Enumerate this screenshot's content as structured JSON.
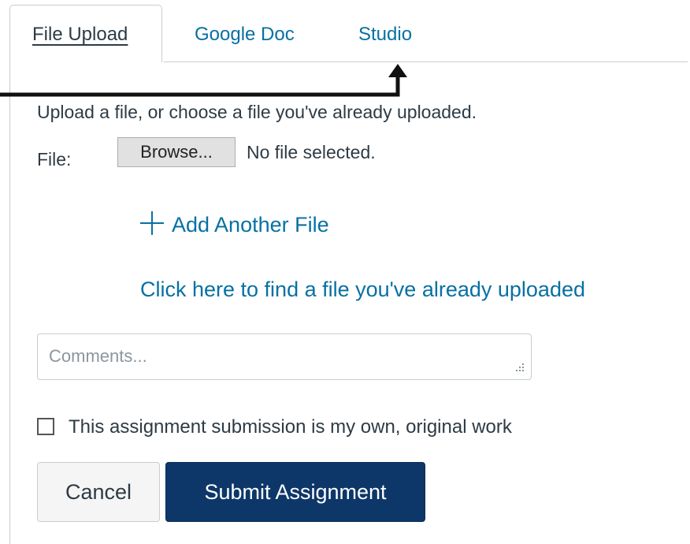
{
  "tabs": [
    {
      "label": "File Upload",
      "active": true
    },
    {
      "label": "Google Doc",
      "active": false
    },
    {
      "label": "Studio",
      "active": false
    }
  ],
  "upload": {
    "instructions": "Upload a file, or choose a file you've already uploaded.",
    "file_label": "File:",
    "browse_label": "Browse...",
    "file_status": "No file selected.",
    "add_file_label": "Add Another File",
    "find_file_link": "Click here to find a file you've already uploaded"
  },
  "comments": {
    "placeholder": "Comments...",
    "value": ""
  },
  "originality": {
    "label": "This assignment submission is my own, original work",
    "checked": false
  },
  "actions": {
    "cancel_label": "Cancel",
    "submit_label": "Submit Assignment"
  },
  "colors": {
    "link": "#0770a3",
    "submit_bg": "#0d3768",
    "border": "#c7cdd1",
    "annotation": "#111111"
  },
  "icons": {
    "add_file": "plus-icon",
    "annotation": "arrow-up-icon",
    "resize": "resize-grip-icon"
  }
}
